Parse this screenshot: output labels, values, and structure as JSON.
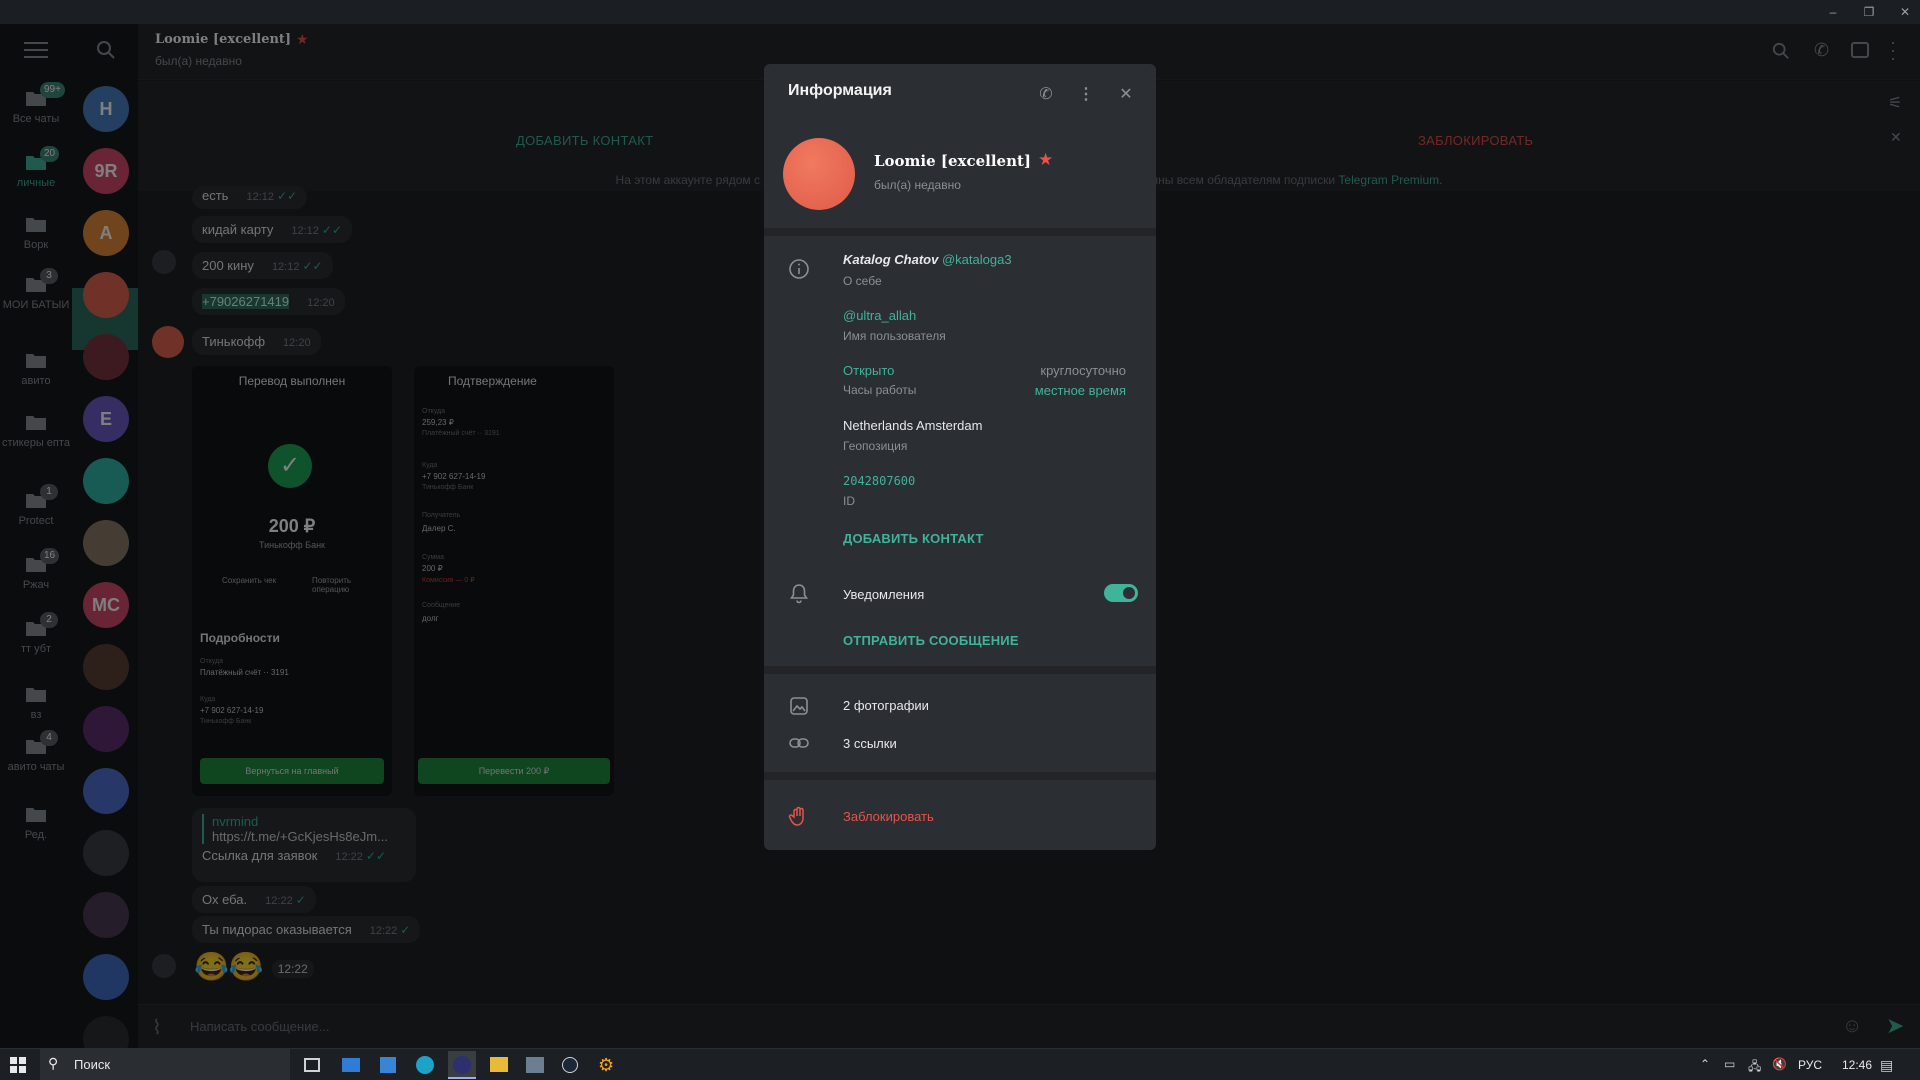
{
  "window": {
    "minimize": "–",
    "restore": "❐",
    "close": "✕"
  },
  "folders": [
    {
      "label": "Все чаты",
      "badge": "99+",
      "icon": "chat-bubbles-icon",
      "active": false
    },
    {
      "label": "личные",
      "badge": "20",
      "icon": "cat-icon",
      "active": true
    },
    {
      "label": "Ворк",
      "badge": "",
      "icon": "folder-icon",
      "active": false
    },
    {
      "label": "МОИ БАТЫИ",
      "badge": "3",
      "icon": "folder-icon",
      "active": false
    },
    {
      "label": "авито",
      "badge": "",
      "icon": "folder-icon",
      "active": false
    },
    {
      "label": "стикеры ептa",
      "badge": "",
      "icon": "folder-icon",
      "active": false
    },
    {
      "label": "Protect",
      "badge": "1",
      "icon": "folder-icon",
      "active": false
    },
    {
      "label": "Ржач",
      "badge": "16",
      "icon": "folder-icon",
      "active": false
    },
    {
      "label": "тт убт",
      "badge": "2",
      "icon": "folder-icon",
      "active": false
    },
    {
      "label": "вз",
      "badge": "",
      "icon": "folder-icon",
      "active": false
    },
    {
      "label": "авито чаты",
      "badge": "4",
      "icon": "folder-icon",
      "active": false
    },
    {
      "label": "Ред.",
      "badge": "",
      "icon": "edit-folders-icon",
      "active": false
    }
  ],
  "avatars": [
    {
      "letter": "H",
      "color": "#4a7fc1"
    },
    {
      "letter": "9R",
      "color": "#d24b6a"
    },
    {
      "letter": "A",
      "color": "#e08a3c"
    },
    {
      "letter": "",
      "color": "#e06550"
    },
    {
      "letter": "",
      "color": "#7a3440"
    },
    {
      "letter": "E",
      "color": "#6c5cc7"
    },
    {
      "letter": "",
      "color": "#2fb6a8"
    },
    {
      "letter": "",
      "color": "#8a7a68"
    },
    {
      "letter": "MC",
      "color": "#d24b6a"
    },
    {
      "letter": "",
      "color": "#5a4034"
    },
    {
      "letter": "",
      "color": "#5c2f6e"
    },
    {
      "letter": "",
      "color": "#4f6fd0"
    },
    {
      "letter": "",
      "color": "#3a3f44"
    },
    {
      "letter": "",
      "color": "#4b3a55"
    },
    {
      "letter": "",
      "color": "#3f6fc4"
    },
    {
      "letter": "",
      "color": "#2d2f33"
    }
  ],
  "chat": {
    "name": "Loomie [excellent]",
    "status": "был(а) недавно",
    "add_contact": "ДОБАВИТЬ КОНТАКТ",
    "block": "ЗАБЛОКИРОВАТЬ",
    "notice_left": "На этом аккаунте рядом с име",
    "notice_right": "пны всем обладателям подписки",
    "notice_link": "Telegram Premium.",
    "composer_placeholder": "Написать сообщение..."
  },
  "messages": [
    {
      "text": "есть",
      "time": "12:12"
    },
    {
      "text": "кидай карту",
      "time": "12:12"
    },
    {
      "text": "200 кину",
      "time": "12:12"
    },
    {
      "text": "+79026271419",
      "time": "12:20"
    },
    {
      "text": "Тинькофф",
      "time": "12:20"
    },
    {
      "text": "Ссылка для заявок",
      "time": "12:22",
      "reply_name": "nvrmind",
      "reply_url": "https://t.me/+GcKjesHs8eJm..."
    },
    {
      "text": "Ох еба.",
      "time": "12:22"
    },
    {
      "text": "Ты пидорас оказывается",
      "time": "12:22"
    },
    {
      "text": "😂😂",
      "time": "12:22"
    }
  ],
  "shot_left": {
    "title": "Перевод выполнен",
    "amount": "200 ₽",
    "bank": "Тинькофф Банк",
    "save": "Сохранить чек",
    "repeat": "Повторить операцию",
    "details": "Подробности",
    "from_label": "Откуда",
    "from_value": "Платёжный счёт ·· 3191",
    "to_label": "Куда",
    "to_value": "+7 902 627-14-19",
    "to_bank": "Тинькофф Банк",
    "back_button": "Вернуться на главный"
  },
  "shot_right": {
    "title": "Подтверждение",
    "from_label": "Откуда",
    "from_value": "259,23 ₽",
    "from_sub": "Платёжный счёт ·· 3191",
    "to_label": "Куда",
    "to_value": "+7 902 627-14-19",
    "to_sub": "Тинькофф Банк",
    "rec_label": "Получатель",
    "rec_value": "Далер С.",
    "sum_label": "Сумма",
    "sum_value": "200 ₽",
    "fee": "Комиссия — 0 ₽",
    "msg_label": "Сообщение",
    "msg_value": "долг",
    "pay_button": "Перевести 200 ₽"
  },
  "modal": {
    "title": "Информация",
    "name": "Loomie [excellent]",
    "status": "был(а) недавно",
    "bio_name": "Katalog Chatov",
    "bio_link": "@kataloga3",
    "bio_label": "О себе",
    "username": "@ultra_allah",
    "username_label": "Имя пользователя",
    "hours_status": "Открыто",
    "hours_value": "круглосуточно",
    "hours_label": "Часы работы",
    "hours_local": "местное время",
    "location": "Netherlands Amsterdam",
    "location_label": "Геопозиция",
    "id": "2042807600",
    "id_label": "ID",
    "add_contact": "ДОБАВИТЬ КОНТАКТ",
    "notifications": "Уведомления",
    "notifications_on": true,
    "send_message": "ОТПРАВИТЬ СООБЩЕНИЕ",
    "photos": "2 фотографии",
    "links": "3 ссылки",
    "block": "Заблокировать"
  },
  "taskbar": {
    "search": "Поиск",
    "lang": "РУС",
    "time": "12:46"
  },
  "colors": {
    "accent": "#40b39b",
    "danger": "#e5534b",
    "modal_bg": "#2b2e33"
  }
}
